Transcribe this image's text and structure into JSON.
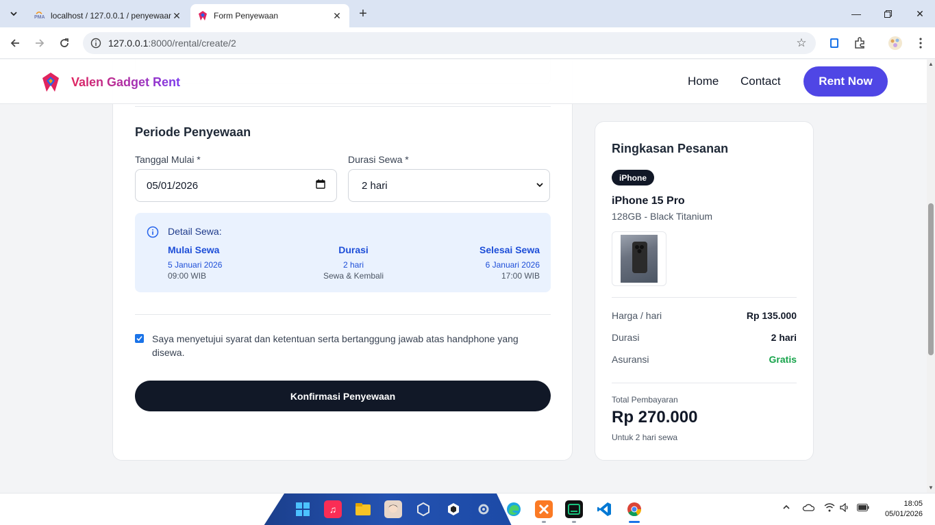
{
  "browser": {
    "tabs": [
      {
        "title": "localhost / 127.0.0.1 / penyewaan",
        "active": false
      },
      {
        "title": "Form Penyewaan",
        "active": true
      }
    ],
    "url_host": "127.0.0.1",
    "url_rest": ":8000/rental/create/2"
  },
  "site": {
    "brand": "Valen Gadget Rent",
    "nav": {
      "home": "Home",
      "contact": "Contact",
      "cta": "Rent Now"
    }
  },
  "form": {
    "section_title": "Periode Penyewaan",
    "start_label": "Tanggal Mulai *",
    "start_value": "05/01/2026",
    "duration_label": "Durasi Sewa *",
    "duration_value": "2 hari",
    "detail": {
      "title": "Detail Sewa:",
      "start": {
        "heading": "Mulai Sewa",
        "date": "5 Januari 2026",
        "time": "09:00 WIB"
      },
      "duration": {
        "heading": "Durasi",
        "value": "2 hari",
        "note": "Sewa & Kembali"
      },
      "end": {
        "heading": "Selesai Sewa",
        "date": "6 Januari 2026",
        "time": "17:00 WIB"
      }
    },
    "agreement_checked": true,
    "agreement_text": "Saya menyetujui syarat dan ketentuan serta bertanggung jawab atas handphone yang disewa.",
    "submit_label": "Konfirmasi Penyewaan"
  },
  "summary": {
    "title": "Ringkasan Pesanan",
    "category_badge": "iPhone",
    "product_name": "iPhone 15 Pro",
    "variant": "128GB - Black Titanium",
    "rows": [
      {
        "label": "Harga / hari",
        "value": "Rp 135.000"
      },
      {
        "label": "Durasi",
        "value": "2 hari"
      },
      {
        "label": "Asuransi",
        "value": "Gratis"
      }
    ],
    "total_label": "Total Pembayaran",
    "total_value": "Rp 270.000",
    "total_note": "Untuk 2 hari sewa"
  },
  "taskbar": {
    "time": "18:05",
    "date": "05/01/2026"
  },
  "colors": {
    "accent": "#4f46e5",
    "dark_button": "#111827",
    "info_bg": "#eaf2fe",
    "info_text": "#1d4ed8",
    "success": "#16a34a"
  }
}
